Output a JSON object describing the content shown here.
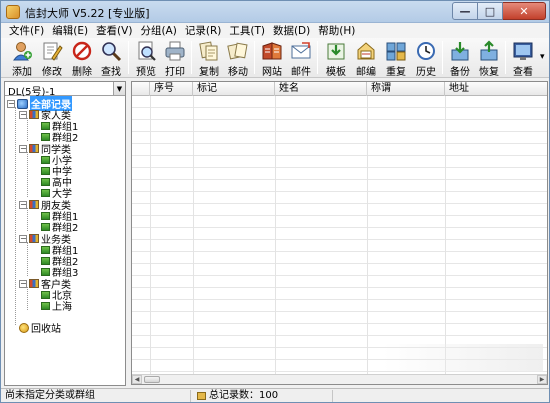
{
  "window": {
    "title": "信封大师 V5.22 [专业版]",
    "watermark": "GIDASOFT",
    "controls": {
      "minimize": "—",
      "maximize": "□",
      "close": "✕"
    }
  },
  "menu": [
    {
      "label": "文件(F)"
    },
    {
      "label": "编辑(E)"
    },
    {
      "label": "查看(V)"
    },
    {
      "label": "分组(A)"
    },
    {
      "label": "记录(R)"
    },
    {
      "label": "工具(T)"
    },
    {
      "label": "数据(D)"
    },
    {
      "label": "帮助(H)"
    }
  ],
  "toolbar": {
    "buttons": [
      {
        "label": "添加",
        "icon": "add-person-icon"
      },
      {
        "label": "修改",
        "icon": "edit-icon"
      },
      {
        "label": "删除",
        "icon": "delete-icon"
      },
      {
        "label": "查找",
        "icon": "search-icon"
      },
      {
        "label": "预览",
        "icon": "preview-icon"
      },
      {
        "label": "打印",
        "icon": "printer-icon"
      },
      {
        "label": "复制",
        "icon": "copy-icon"
      },
      {
        "label": "移动",
        "icon": "move-icon"
      },
      {
        "label": "网站",
        "icon": "website-icon"
      },
      {
        "label": "邮件",
        "icon": "mail-icon"
      },
      {
        "label": "模板",
        "icon": "template-icon"
      },
      {
        "label": "邮编",
        "icon": "postcode-icon"
      },
      {
        "label": "重复",
        "icon": "duplicate-icon"
      },
      {
        "label": "历史",
        "icon": "history-icon"
      },
      {
        "label": "备份",
        "icon": "backup-icon"
      },
      {
        "label": "恢复",
        "icon": "restore-icon"
      },
      {
        "label": "查看",
        "icon": "view-icon"
      }
    ],
    "more": "▾"
  },
  "left_panel": {
    "combo_value": "DL(5号)-1",
    "combo_arrow": "▼",
    "tree": {
      "root": "全部记录",
      "groups": [
        {
          "label": "家人类",
          "children": [
            "群组1",
            "群组2"
          ]
        },
        {
          "label": "同学类",
          "children": [
            "小学",
            "中学",
            "高中",
            "大学"
          ]
        },
        {
          "label": "朋友类",
          "children": [
            "群组1",
            "群组2"
          ]
        },
        {
          "label": "业务类",
          "children": [
            "群组1",
            "群组2",
            "群组3"
          ]
        },
        {
          "label": "客户类",
          "children": [
            "北京",
            "上海"
          ]
        }
      ],
      "recycle": "回收站",
      "expanded_marker": "−"
    }
  },
  "grid": {
    "columns": [
      "序号",
      "标记",
      "姓名",
      "称谓",
      "地址"
    ],
    "scroll_left": "◀",
    "scroll_right": "▶"
  },
  "status": {
    "left": "尚未指定分类或群组",
    "record_count": "总记录数：100"
  }
}
